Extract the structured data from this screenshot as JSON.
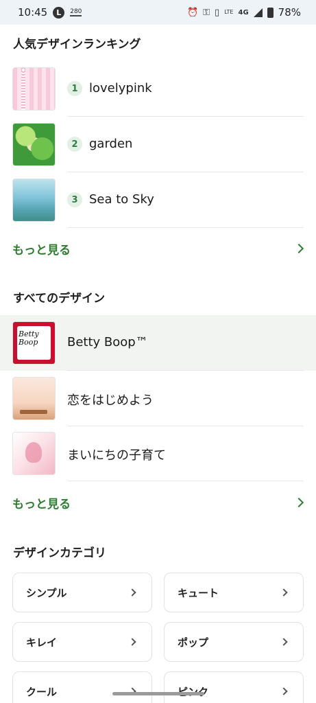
{
  "status_bar": {
    "time": "10:45",
    "notif_label": "280",
    "network_label": "4G",
    "lte_label": "LTE",
    "battery": "78%"
  },
  "ranking": {
    "title": "人気デザインランキング",
    "items": [
      {
        "rank": "1",
        "name": "lovelypink"
      },
      {
        "rank": "2",
        "name": "garden"
      },
      {
        "rank": "3",
        "name": "Sea to Sky"
      }
    ],
    "more_label": "もっと見る"
  },
  "all_designs": {
    "title": "すべてのデザイン",
    "items": [
      {
        "name": "Betty Boop™",
        "thumb_text": "Betty Boop"
      },
      {
        "name": "恋をはじめよう"
      },
      {
        "name": "まいにちの子育て"
      }
    ],
    "more_label": "もっと見る"
  },
  "categories": {
    "title": "デザインカテゴリ",
    "items": [
      {
        "label": "シンプル"
      },
      {
        "label": "キュート"
      },
      {
        "label": "キレイ"
      },
      {
        "label": "ポップ"
      },
      {
        "label": "クール"
      },
      {
        "label": "ピンク"
      }
    ]
  },
  "colors": {
    "accent": "#2e7d32",
    "badge_bg": "#e3f0e6",
    "selected_row": "#f2f4f2"
  }
}
